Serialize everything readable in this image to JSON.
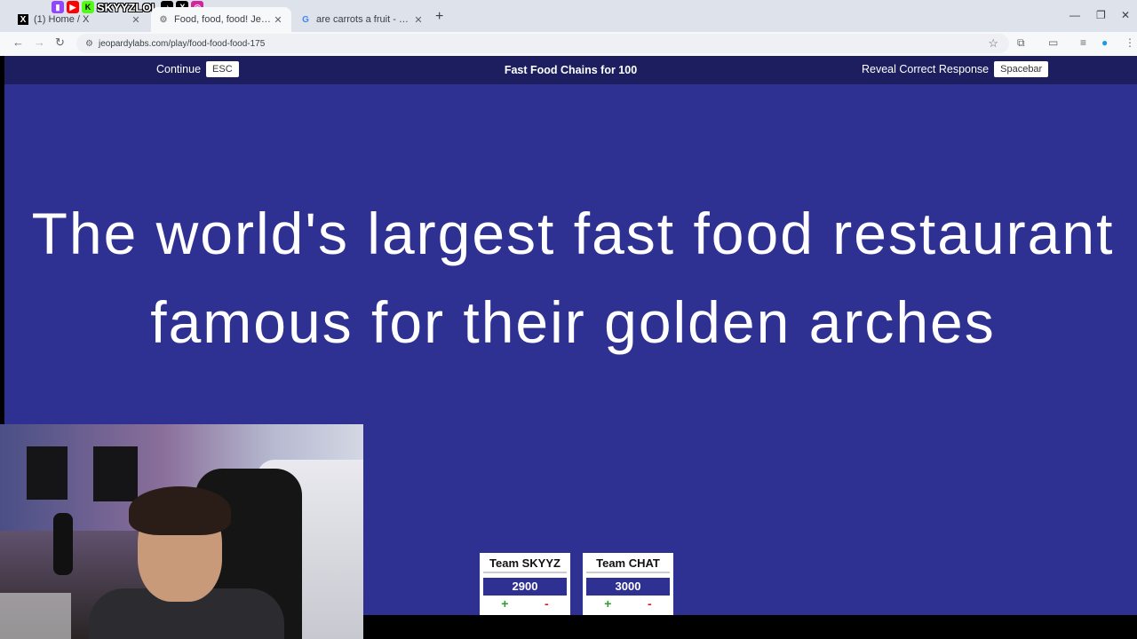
{
  "browser": {
    "tabs": [
      {
        "title": "(1) Home / X",
        "icon": "x-logo-icon",
        "active": false
      },
      {
        "title": "Food, food, food! Jeopardy Template",
        "icon": "jeopardy-favicon-icon",
        "active": true
      },
      {
        "title": "are carrots a fruit - Google Search",
        "icon": "google-icon",
        "active": false
      }
    ],
    "url": "jeopardylabs.com/play/food-food-food-175",
    "overlay_brand": "SKYYZLOL"
  },
  "game": {
    "continue_label": "Continue",
    "continue_key": "ESC",
    "category_title": "Fast Food Chains for 100",
    "reveal_label": "Reveal Correct Response",
    "reveal_key": "Spacebar",
    "clue_text": "The world's largest fast food restaurant famous for their golden arches"
  },
  "teams": [
    {
      "name": "Team SKYYZ",
      "score": "2900",
      "plus": "+",
      "minus": "-"
    },
    {
      "name": "Team CHAT",
      "score": "3000",
      "plus": "+",
      "minus": "-"
    }
  ],
  "colors": {
    "page_bg": "#2e3192",
    "topbar_bg": "#1c1e60",
    "plus": "#2a9d2a",
    "minus": "#d81f1f"
  }
}
